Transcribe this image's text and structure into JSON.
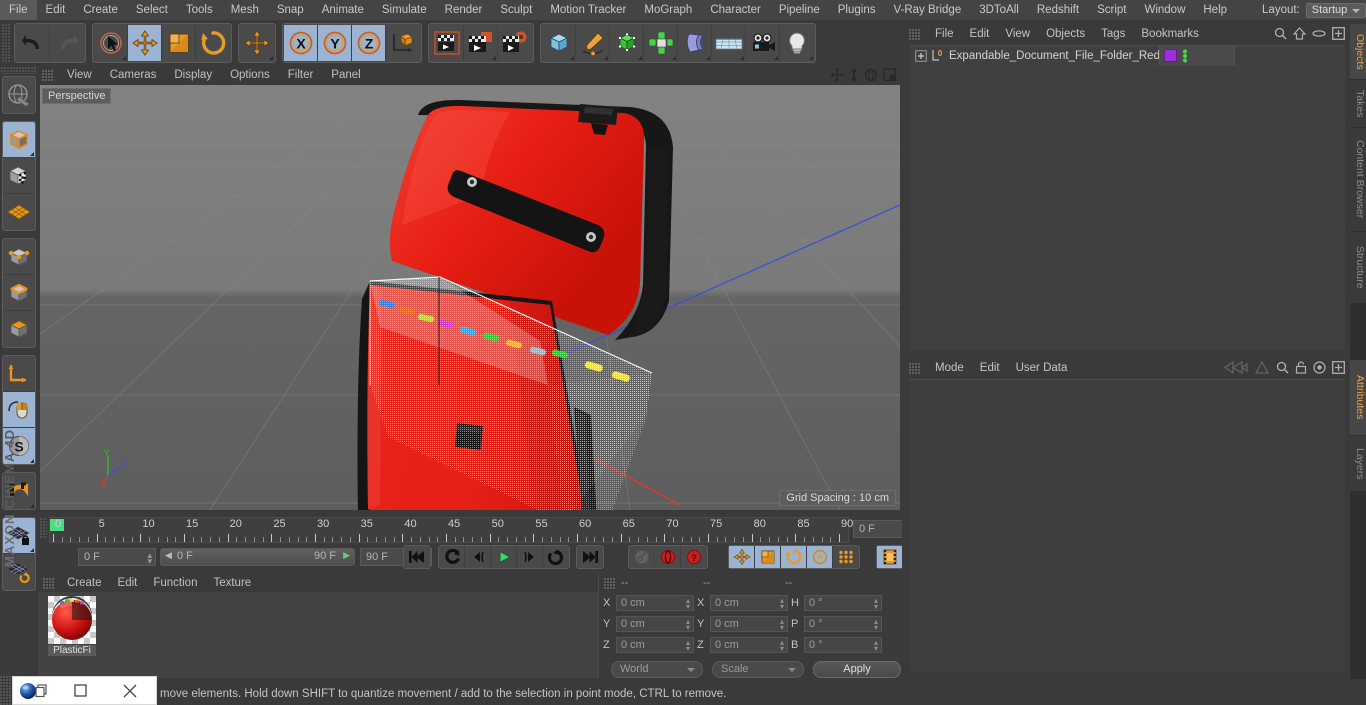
{
  "app": {
    "brand": "MAXON",
    "brand2": "CINEMA 4D"
  },
  "menubar": {
    "items": [
      "File",
      "Edit",
      "Create",
      "Select",
      "Tools",
      "Mesh",
      "Snap",
      "Animate",
      "Simulate",
      "Render",
      "Sculpt",
      "Motion Tracker",
      "MoGraph",
      "Character",
      "Pipeline",
      "Plugins",
      "V-Ray Bridge",
      "3DToAll",
      "Redshift",
      "Script",
      "Window",
      "Help"
    ],
    "layout_label": "Layout:",
    "layout_value": "Startup",
    "search_icon": "search-icon"
  },
  "toolbar": {
    "undo_label": "Undo",
    "redo_label": "Redo",
    "select_label": "Live Selection",
    "move_label": "Move",
    "scale_label": "Scale",
    "rotate_label": "Rotate",
    "move2_label": "Move",
    "x_label": "X",
    "y_label": "Y",
    "z_label": "Z",
    "world_label": "World/Object",
    "render_view_label": "Render View",
    "render_region_label": "Render Region",
    "render_settings_label": "Render Settings",
    "cube_label": "Cube",
    "spline_label": "Spline Pen",
    "nurbs_label": "Subdivision Surface",
    "array_label": "Array",
    "deformer_label": "Bend",
    "floor_label": "Floor",
    "camera_label": "Camera",
    "light_label": "Light"
  },
  "lefttoolbar": {
    "items": [
      {
        "name": "make-editable-icon",
        "label": "Make Editable",
        "selected": false
      },
      {
        "name": "model-mode-icon",
        "label": "Model Mode",
        "selected": true
      },
      {
        "name": "texture-mode-icon",
        "label": "Texture Mode",
        "selected": false
      },
      {
        "name": "uv-mesh-icon",
        "label": "UV Mesh",
        "selected": false
      },
      {
        "name": "points-mode-icon",
        "label": "Points Mode",
        "selected": false
      },
      {
        "name": "edges-mode-icon",
        "label": "Edges Mode",
        "selected": false
      },
      {
        "name": "polygons-mode-icon",
        "label": "Polygons Mode",
        "selected": false
      },
      {
        "name": "axis-modify-icon",
        "label": "Enable Axis Modification",
        "selected": false
      },
      {
        "name": "viewport-solo-icon",
        "label": "Viewport Solo",
        "selected": true
      },
      {
        "name": "workplane-icon",
        "label": "Workplane",
        "selected": true
      },
      {
        "name": "snap-icon",
        "label": "Enable Snapping",
        "selected": false
      },
      {
        "name": "lock-workplane-icon",
        "label": "Lock Workplane",
        "selected": true
      },
      {
        "name": "planar-workplane-icon",
        "label": "Planar Workplane",
        "selected": false
      }
    ]
  },
  "viewport": {
    "menu": [
      "View",
      "Cameras",
      "Display",
      "Options",
      "Filter",
      "Panel"
    ],
    "perspective_label": "Perspective",
    "grid_spacing_label": "Grid Spacing : 10 cm",
    "axis_x": "X",
    "axis_y": "Y",
    "axis_z": "Z",
    "icons": [
      "pan-icon",
      "dolly-icon",
      "rotate-icon",
      "maximize-icon"
    ],
    "model_name": "Expandable Document File Folder Red Open",
    "model_color": "#e02020"
  },
  "timeline": {
    "ticks": [
      0,
      5,
      10,
      15,
      20,
      25,
      30,
      35,
      40,
      45,
      50,
      55,
      60,
      65,
      70,
      75,
      80,
      85,
      90
    ],
    "current_frame_field": "0 F",
    "start_frame": "0 F",
    "range_start": "0 F",
    "range_end": "90 F",
    "end_frame": "90 F",
    "transport": [
      {
        "name": "goto-start-button",
        "label": "Go to Start"
      },
      {
        "name": "play-backwards-button",
        "label": "Play Backwards"
      },
      {
        "name": "previous-frame-button",
        "label": "Previous Frame"
      },
      {
        "name": "play-forward-button",
        "label": "Play Forwards"
      },
      {
        "name": "next-frame-button",
        "label": "Next Frame"
      },
      {
        "name": "loop-button",
        "label": "Loop"
      },
      {
        "name": "goto-end-button",
        "label": "Go to End"
      }
    ],
    "record_buttons": [
      {
        "name": "record-key-button",
        "label": "Record Active Objects",
        "enabled": false
      },
      {
        "name": "autokey-button",
        "label": "Autokeying",
        "enabled": true
      },
      {
        "name": "keyframe-selection-button",
        "label": "Keyframe Selection",
        "enabled": true
      }
    ],
    "param_buttons": [
      {
        "name": "position-key-button",
        "label": "Position",
        "selected": true
      },
      {
        "name": "scale-key-button",
        "label": "Scale",
        "selected": true
      },
      {
        "name": "rotation-key-button",
        "label": "Rotation",
        "selected": true
      },
      {
        "name": "param-key-button",
        "label": "Parameter",
        "selected": true
      },
      {
        "name": "pla-key-button",
        "label": "Point Level Animation",
        "selected": false
      },
      {
        "name": "timeline-toggle-button",
        "label": "Animation Mode",
        "selected": true
      }
    ]
  },
  "materials": {
    "menu": [
      "Create",
      "Edit",
      "Function",
      "Texture"
    ],
    "items": [
      {
        "name": "PlasticFi",
        "color": "#cc1111"
      }
    ]
  },
  "coordinates": {
    "header_dashes": [
      "--",
      "--",
      "--"
    ],
    "col1_labels": [
      "X",
      "Y",
      "Z"
    ],
    "col1_values": [
      "0 cm",
      "0 cm",
      "0 cm"
    ],
    "col2_labels": [
      "X",
      "Y",
      "Z"
    ],
    "col2_values": [
      "0 cm",
      "0 cm",
      "0 cm"
    ],
    "col3_labels": [
      "H",
      "P",
      "B"
    ],
    "col3_values": [
      "0 °",
      "0 °",
      "0 °"
    ],
    "system_value": "World",
    "mode_value": "Scale",
    "apply_label": "Apply"
  },
  "object_manager": {
    "menu": [
      "File",
      "Edit",
      "View",
      "Objects",
      "Tags",
      "Bookmarks"
    ],
    "icons": [
      "search-icon",
      "home-icon",
      "ellipse-icon",
      "fullscreen-icon"
    ],
    "rows": [
      {
        "name": "Expandable_Document_File_Folder_Red_Open",
        "level_badge": "0",
        "tag_color": "#9b30d9",
        "has_expand": true
      }
    ]
  },
  "attribute_manager": {
    "menu": [
      "Mode",
      "Edit",
      "User Data"
    ],
    "icons": [
      "history-back-icon",
      "history-forward-icon",
      "search-icon",
      "lock-icon",
      "target-icon",
      "fullscreen-icon"
    ]
  },
  "right_tabs": [
    {
      "label": "Objects",
      "active": true
    },
    {
      "label": "Takes",
      "active": false
    },
    {
      "label": "Content Browser",
      "active": false
    },
    {
      "label": "Structure",
      "active": false
    }
  ],
  "right_tabs_lower": [
    {
      "label": "Attributes",
      "active": true
    },
    {
      "label": "Layers",
      "active": false
    }
  ],
  "statusbar": {
    "text": "move elements. Hold down SHIFT to quantize movement / add to the selection in point mode, CTRL to remove."
  },
  "window_overlay": {
    "app_icon": "app-icon",
    "restore_label": "restore-icon",
    "maximize_label": "maximize-icon",
    "close_label": "close-icon"
  },
  "colors": {
    "panel_bg": "#3a3a3a",
    "selected_blue": "#9bb4d4",
    "accent_orange": "#e8a04a",
    "model_red": "#e02020"
  }
}
